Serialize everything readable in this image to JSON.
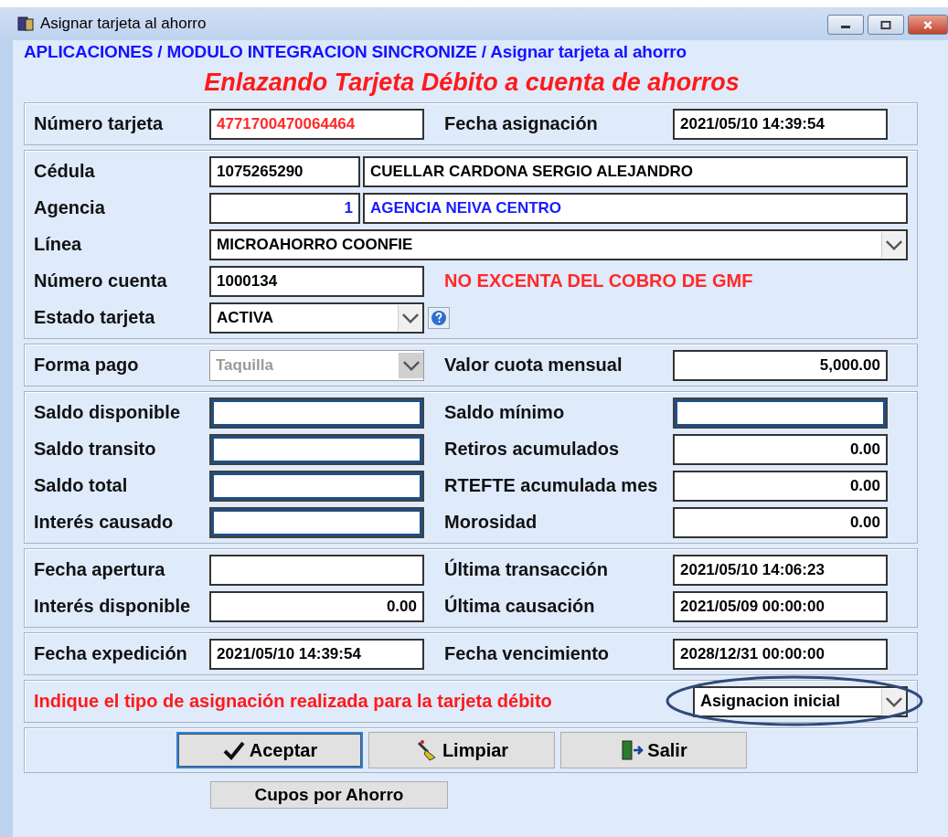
{
  "window": {
    "title": "Asignar tarjeta al ahorro"
  },
  "breadcrumb": "APLICACIONES / MODULO INTEGRACION SINCRONIZE / Asignar tarjeta al ahorro",
  "heading": "Enlazando Tarjeta Débito a cuenta de ahorros",
  "sections": [
    {
      "rows": [
        [
          {
            "kind": "label",
            "text": "Número tarjeta"
          },
          {
            "kind": "field",
            "value": "4771700470064464",
            "color": "#ff2a2a"
          },
          {
            "kind": "label-right",
            "text": "Fecha asignación"
          },
          {
            "kind": "field",
            "value": "2021/05/10 14:39:54"
          }
        ]
      ]
    },
    {
      "rows": [
        [
          {
            "kind": "label",
            "text": "Cédula"
          },
          {
            "kind": "code-field",
            "value": "1075265290"
          },
          {
            "kind": "name-field",
            "value": "CUELLAR CARDONA SERGIO ALEJANDRO"
          }
        ],
        [
          {
            "kind": "label",
            "text": "Agencia"
          },
          {
            "kind": "code-number",
            "value": "1",
            "color": "#1a1aff"
          },
          {
            "kind": "name-field",
            "value": "AGENCIA NEIVA CENTRO",
            "color": "#1a1aff"
          }
        ],
        [
          {
            "kind": "label",
            "text": "Línea"
          },
          {
            "kind": "wide-combo",
            "value": "MICROAHORRO COONFIE"
          }
        ],
        [
          {
            "kind": "label",
            "text": "Número cuenta"
          },
          {
            "kind": "field",
            "value": "1000134"
          },
          {
            "kind": "note",
            "text": "NO EXCENTA DEL COBRO DE GMF"
          }
        ],
        [
          {
            "kind": "label",
            "text": "Estado tarjeta"
          },
          {
            "kind": "combo",
            "value": "ACTIVA"
          },
          {
            "kind": "help"
          }
        ]
      ]
    },
    {
      "rows": [
        [
          {
            "kind": "label",
            "text": "Forma pago"
          },
          {
            "kind": "combo",
            "value": "Taquilla",
            "disabled": true
          },
          {
            "kind": "label-right",
            "text": "Valor cuota mensual"
          },
          {
            "kind": "number-field",
            "value": "5,000.00"
          }
        ]
      ]
    },
    {
      "rows": [
        [
          {
            "kind": "label",
            "text": "Saldo disponible"
          },
          {
            "kind": "field",
            "highlighted": true
          },
          {
            "kind": "label-right",
            "text": "Saldo mínimo"
          },
          {
            "kind": "field",
            "highlighted": true
          }
        ],
        [
          {
            "kind": "label",
            "text": "Saldo transito"
          },
          {
            "kind": "field",
            "highlighted": true
          },
          {
            "kind": "label-right",
            "text": "Retiros acumulados"
          },
          {
            "kind": "number-field",
            "value": "0.00"
          }
        ],
        [
          {
            "kind": "label",
            "text": "Saldo total"
          },
          {
            "kind": "field",
            "highlighted": true
          },
          {
            "kind": "label-right",
            "text": "RTEFTE acumulada mes"
          },
          {
            "kind": "number-field",
            "value": "0.00"
          }
        ],
        [
          {
            "kind": "label",
            "text": "Interés causado"
          },
          {
            "kind": "field",
            "highlighted": true
          },
          {
            "kind": "label-right",
            "text": "Morosidad"
          },
          {
            "kind": "number-field",
            "value": "0.00"
          }
        ]
      ]
    },
    {
      "rows": [
        [
          {
            "kind": "label",
            "text": "Fecha apertura"
          },
          {
            "kind": "field"
          },
          {
            "kind": "label-right",
            "text": "Última transacción"
          },
          {
            "kind": "field",
            "value": "2021/05/10 14:06:23"
          }
        ],
        [
          {
            "kind": "label",
            "text": "Interés disponible"
          },
          {
            "kind": "number-field",
            "value": "0.00"
          },
          {
            "kind": "label-right",
            "text": "Última causación"
          },
          {
            "kind": "field",
            "value": "2021/05/09 00:00:00"
          }
        ]
      ]
    },
    {
      "rows": [
        [
          {
            "kind": "label",
            "text": "Fecha expedición"
          },
          {
            "kind": "field",
            "value": "2021/05/10 14:39:54"
          },
          {
            "kind": "label-right",
            "text": "Fecha vencimiento"
          },
          {
            "kind": "field",
            "value": "2028/12/31 00:00:00"
          }
        ]
      ]
    },
    {
      "rows": [
        [
          {
            "kind": "prompt",
            "text": "Indique el tipo de asignación realizada para la tarjeta débito"
          },
          {
            "kind": "circled-combo",
            "value": "Asignacion inicial"
          }
        ]
      ]
    }
  ],
  "buttons": [
    {
      "label": "Aceptar",
      "focused": true
    },
    {
      "label": "Limpiar",
      "focused": false
    },
    {
      "label": "Salir",
      "focused": false
    }
  ],
  "extra_button": "Cupos por Ahorro"
}
